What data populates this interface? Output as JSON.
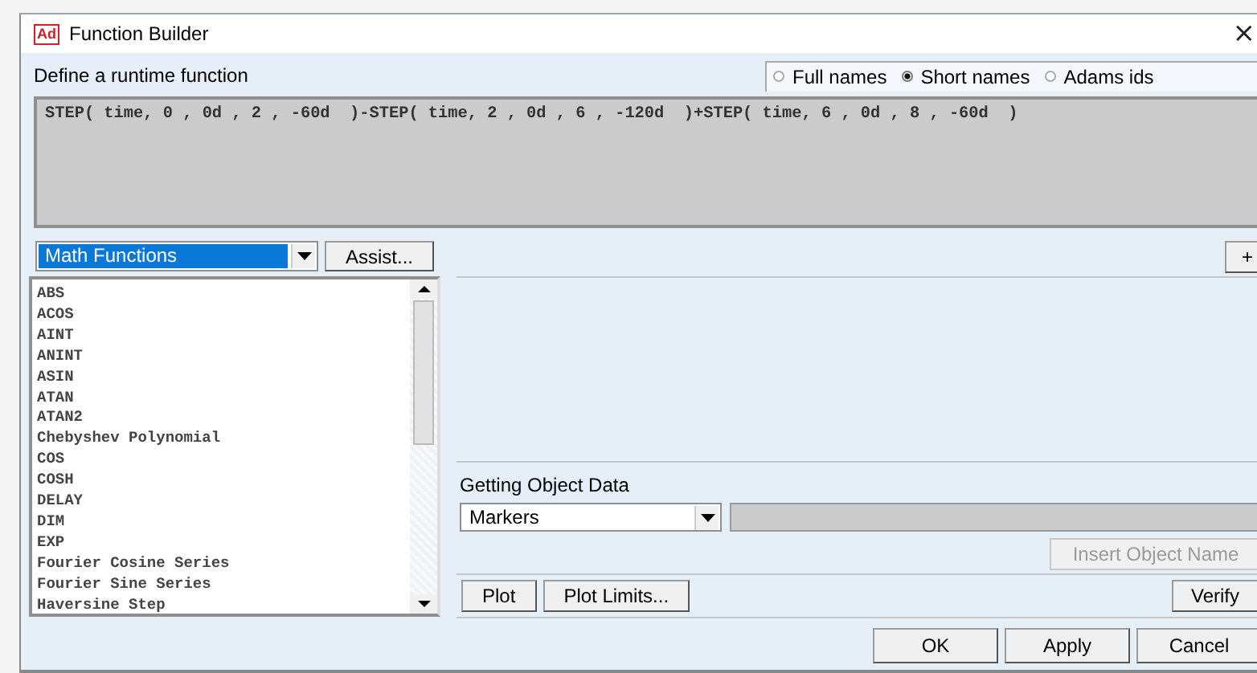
{
  "window": {
    "app_icon": "Ad",
    "title": "Function Builder",
    "close": "×"
  },
  "header": {
    "label": "Define a runtime function"
  },
  "name_options": [
    {
      "label": "Full names",
      "selected": false
    },
    {
      "label": "Short names",
      "selected": true
    },
    {
      "label": "Adams ids",
      "selected": false
    }
  ],
  "function_text": "STEP( time, 0 , 0d , 2 , -60d  )-STEP( time, 2 , 0d , 6 , -120d  )+STEP( time, 6 , 0d , 8 , -60d  )",
  "category_dropdown": {
    "value": "Math Functions",
    "focused": true
  },
  "assist_button": {
    "label": "Assist..."
  },
  "add_button": {
    "label": "+"
  },
  "functions": [
    "ABS",
    "ACOS",
    "AINT",
    "ANINT",
    "ASIN",
    "ATAN",
    "ATAN2",
    "Chebyshev Polynomial",
    "COS",
    "COSH",
    "DELAY",
    "DIM",
    "EXP",
    "Fourier Cosine Series",
    "Fourier Sine Series",
    "Haversine Step"
  ],
  "object_data": {
    "label": "Getting Object Data",
    "type_dropdown": {
      "value": "Markers"
    },
    "insert_button": {
      "label": "Insert Object Name",
      "disabled": true
    }
  },
  "plot_buttons": [
    "Plot",
    "Plot Limits..."
  ],
  "verify_button": {
    "label": "Verify"
  },
  "dialog_buttons": [
    "OK",
    "Apply",
    "Cancel"
  ]
}
